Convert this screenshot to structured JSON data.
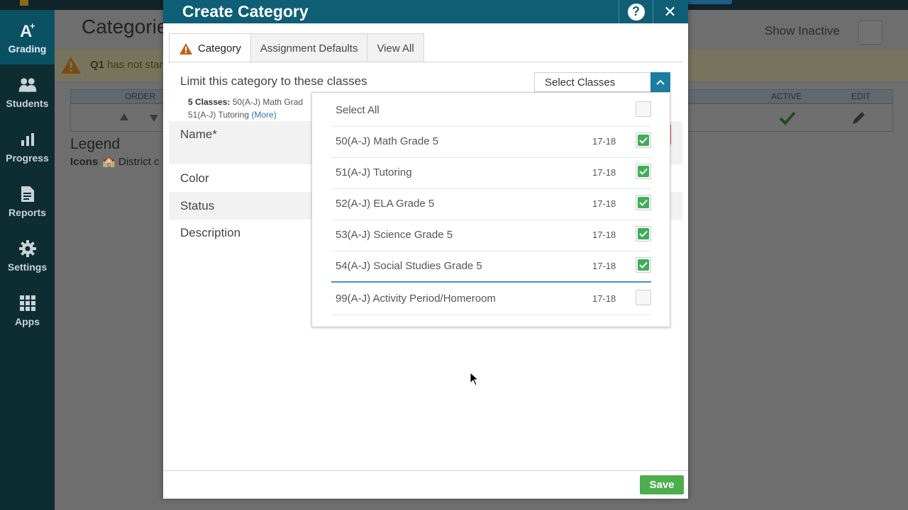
{
  "colors": {
    "sidebar_bg": "#0d2d33",
    "modal_header": "#0e5f76",
    "accent_blue": "#1a7ea0",
    "save_green": "#4cae4c",
    "check_green": "#3fae5a",
    "warning_orange": "#c0651a"
  },
  "sidebar": {
    "items": [
      {
        "label": "Grading",
        "icon": "grading-a-plus-icon",
        "active": true
      },
      {
        "label": "Students",
        "icon": "students-icon"
      },
      {
        "label": "Progress",
        "icon": "progress-chart-icon"
      },
      {
        "label": "Reports",
        "icon": "reports-icon"
      },
      {
        "label": "Settings",
        "icon": "gear-icon"
      },
      {
        "label": "Apps",
        "icon": "apps-grid-icon"
      }
    ]
  },
  "background_page": {
    "title": "Categorie",
    "show_inactive_label": "Show Inactive",
    "warning": {
      "bold": "Q1",
      "text": "has not star"
    },
    "table_headers": {
      "order": "ORDER",
      "active": "ACTIVE",
      "edit": "EDIT"
    },
    "legend_title": "Legend",
    "legend_icons_label": "Icons",
    "legend_icons_text": "District c"
  },
  "modal": {
    "title": "Create Category",
    "help_label": "?",
    "close_label": "✕",
    "tabs": [
      {
        "label": "Category",
        "warning": true,
        "active": true
      },
      {
        "label": "Assignment Defaults"
      },
      {
        "label": "View All"
      }
    ],
    "limit_label": "Limit this category to these classes",
    "classes_summary": {
      "count_label": "5 Classes:",
      "first": "50(A-J) Math Grad",
      "second": "51(A-J) Tutoring",
      "more": "(More)"
    },
    "select_classes_label": "Select Classes",
    "fields": {
      "name": "Name*",
      "color": "Color",
      "status": "Status",
      "description": "Description"
    },
    "save_label": "Save"
  },
  "dropdown": {
    "select_all_label": "Select All",
    "select_all_checked": false,
    "classes": [
      {
        "name": "50(A-J) Math Grade 5",
        "year": "17-18",
        "checked": true
      },
      {
        "name": "51(A-J) Tutoring",
        "year": "17-18",
        "checked": true
      },
      {
        "name": "52(A-J) ELA Grade 5",
        "year": "17-18",
        "checked": true
      },
      {
        "name": "53(A-J) Science Grade 5",
        "year": "17-18",
        "checked": true
      },
      {
        "name": "54(A-J) Social Studies Grade 5",
        "year": "17-18",
        "checked": true
      },
      {
        "name": "99(A-J) Activity Period/Homeroom",
        "year": "17-18",
        "checked": false
      }
    ]
  }
}
